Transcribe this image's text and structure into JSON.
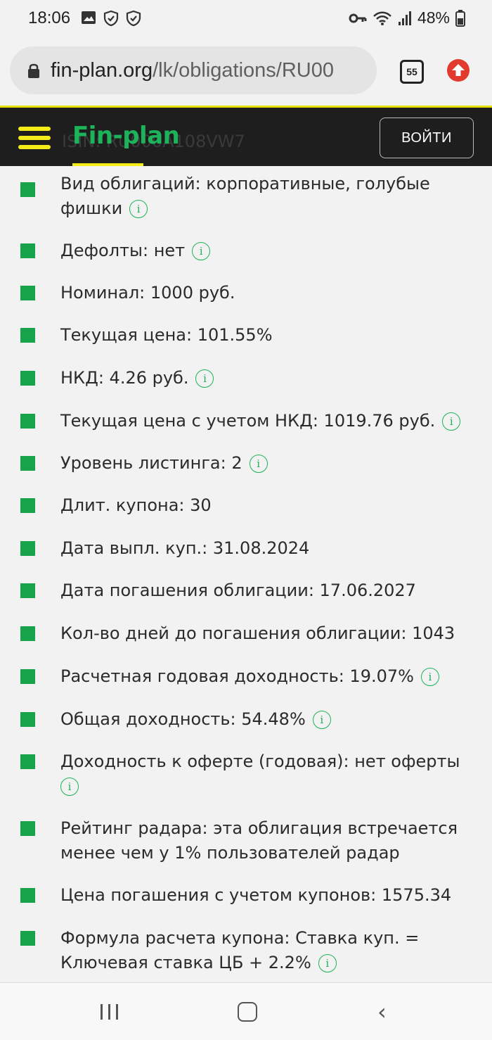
{
  "status_bar": {
    "time": "18:06",
    "battery": "48%",
    "icons": [
      "image-icon",
      "shield-check-icon",
      "shield-check-icon",
      "key-icon",
      "wifi-icon",
      "signal-icon",
      "battery-icon"
    ]
  },
  "browser": {
    "url_host": "fin-plan.org",
    "url_path": "/lk/obligations/RU00",
    "tab_count": "55"
  },
  "site_header": {
    "logo": "Fin-plan",
    "login_label": "ВОЙТИ",
    "obscured_text": "ISIN: RU000A108VW7",
    "accent_color": "#f3ec19",
    "brand_color": "#1db35a"
  },
  "bond_info": {
    "items": [
      {
        "text": "Вид облигаций: корпоративные, голубые фишки",
        "info": true
      },
      {
        "text": "Дефолты: нет",
        "info": true
      },
      {
        "text": "Номинал: 1000 руб.",
        "info": false
      },
      {
        "text": "Текущая цена: 101.55%",
        "info": false
      },
      {
        "text": "НКД: 4.26 руб.",
        "info": true
      },
      {
        "text": "Текущая цена с учетом НКД: 1019.76 руб.",
        "info": true
      },
      {
        "text": "Уровень листинга: 2",
        "info": true
      },
      {
        "text": "Длит. купона: 30",
        "info": false
      },
      {
        "text": "Дата выпл. куп.: 31.08.2024",
        "info": false
      },
      {
        "text": "Дата погашения облигации: 17.06.2027",
        "info": false
      },
      {
        "text": "Кол-во дней до погашения облигации: 1043",
        "info": false
      },
      {
        "text": "Расчетная годовая доходность: 19.07%",
        "info": true
      },
      {
        "text": "Общая доходность: 54.48%",
        "info": true
      },
      {
        "text": "Доходность к оферте (годовая): нет оферты",
        "info": true
      },
      {
        "text": "Рейтинг радара: эта облигация встречается менее чем у 1% пользователей радар",
        "info": false
      },
      {
        "text": "Цена погашения с учетом купонов: 1575.34",
        "info": false
      },
      {
        "text": "Формула расчета купона: Ставка куп. = Ключевая ставка ЦБ + 2.2%",
        "info": true
      }
    ],
    "info_symbol": "i",
    "bullet_color": "#17a34a"
  },
  "nav_bar": {
    "back_symbol": "‹"
  }
}
